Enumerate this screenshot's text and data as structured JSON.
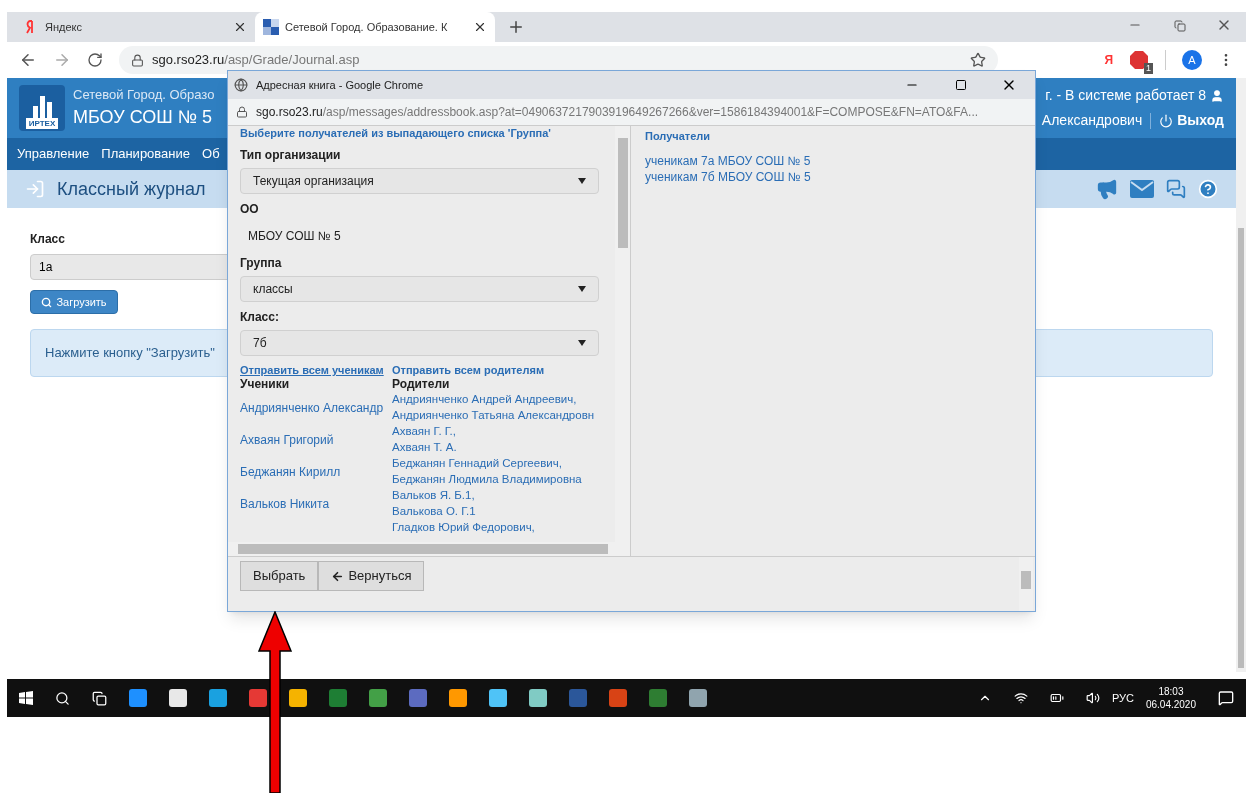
{
  "browser": {
    "tabs": [
      {
        "label": "Яндекс",
        "selected": false
      },
      {
        "label": "Сетевой Город. Образование. К",
        "selected": true
      }
    ],
    "yandex_button": "Я",
    "address": {
      "host": "sgo.rso23.ru",
      "path": "/asp/Grade/Journal.asp"
    },
    "extension_badge": "1",
    "avatar": "A"
  },
  "page": {
    "header": {
      "logo_text": "ИРТЕХ",
      "title": "Сетевой Город. Образо",
      "school": "МБОУ СОШ № 5",
      "status": "г. - В системе работает 8",
      "user": "Александрович",
      "logout": "Выход"
    },
    "nav": [
      "Управление",
      "Планирование",
      "Об"
    ],
    "page_title": "Классный журнал",
    "class_label": "Класс",
    "class_value": "1а",
    "load_button": "Загрузить",
    "notice": "Нажмите кнопку \"Загрузить\""
  },
  "popup": {
    "title": "Адресная книга - Google Chrome",
    "url": {
      "host": "sgo.rso23.ru",
      "path": "/asp/messages/addressbook.asp?at=0490637217903919649267266&ver=1586184394001&F=COMPOSE&FN=ATO&FA..."
    },
    "hint": "Выберите получателей из выпадающего списка 'Группа'",
    "fields": [
      {
        "label": "Тип организации",
        "value": "Текущая организация",
        "kind": "select"
      },
      {
        "label": "ОО",
        "value": "МБОУ СОШ № 5",
        "kind": "text"
      },
      {
        "label": "Группа",
        "value": "классы",
        "kind": "select"
      },
      {
        "label": "Класс:",
        "value": "7б",
        "kind": "select"
      }
    ],
    "send_students": "Отправить всем ученикам",
    "send_parents": "Отправить всем родителям",
    "students_heading": "Ученики",
    "parents_heading": "Родители",
    "rows": [
      {
        "student": "Андриянченко Александр",
        "parents": [
          "Андриянченко Андрей Андреевич,",
          "Андриянченко Татьяна Александровн"
        ]
      },
      {
        "student": "Ахваян Григорий",
        "parents": [
          "Ахваян Г. Г.,",
          "Ахваян Т. А."
        ]
      },
      {
        "student": "Беджанян Кирилл",
        "parents": [
          "Беджанян Геннадий Сергеевич,",
          "Беджанян Людмила Владимировна"
        ]
      },
      {
        "student": "Вальков Никита",
        "parents": [
          "Вальков Я. Б.1,",
          "Валькова О. Г.1"
        ]
      },
      {
        "parents": [
          "Гладков Юрий Федорович,"
        ]
      }
    ],
    "recipients_heading": "Получатели",
    "recipients": [
      "ученикам 7а МБОУ СОШ № 5",
      "ученикам 7б МБОУ СОШ № 5"
    ],
    "buttons": [
      {
        "label": "Выбрать",
        "kind": "plain"
      },
      {
        "label": "Вернуться",
        "kind": "back"
      }
    ]
  },
  "taskbar": {
    "language": "РУС",
    "time": "18:03",
    "date": "06.04.2020"
  }
}
